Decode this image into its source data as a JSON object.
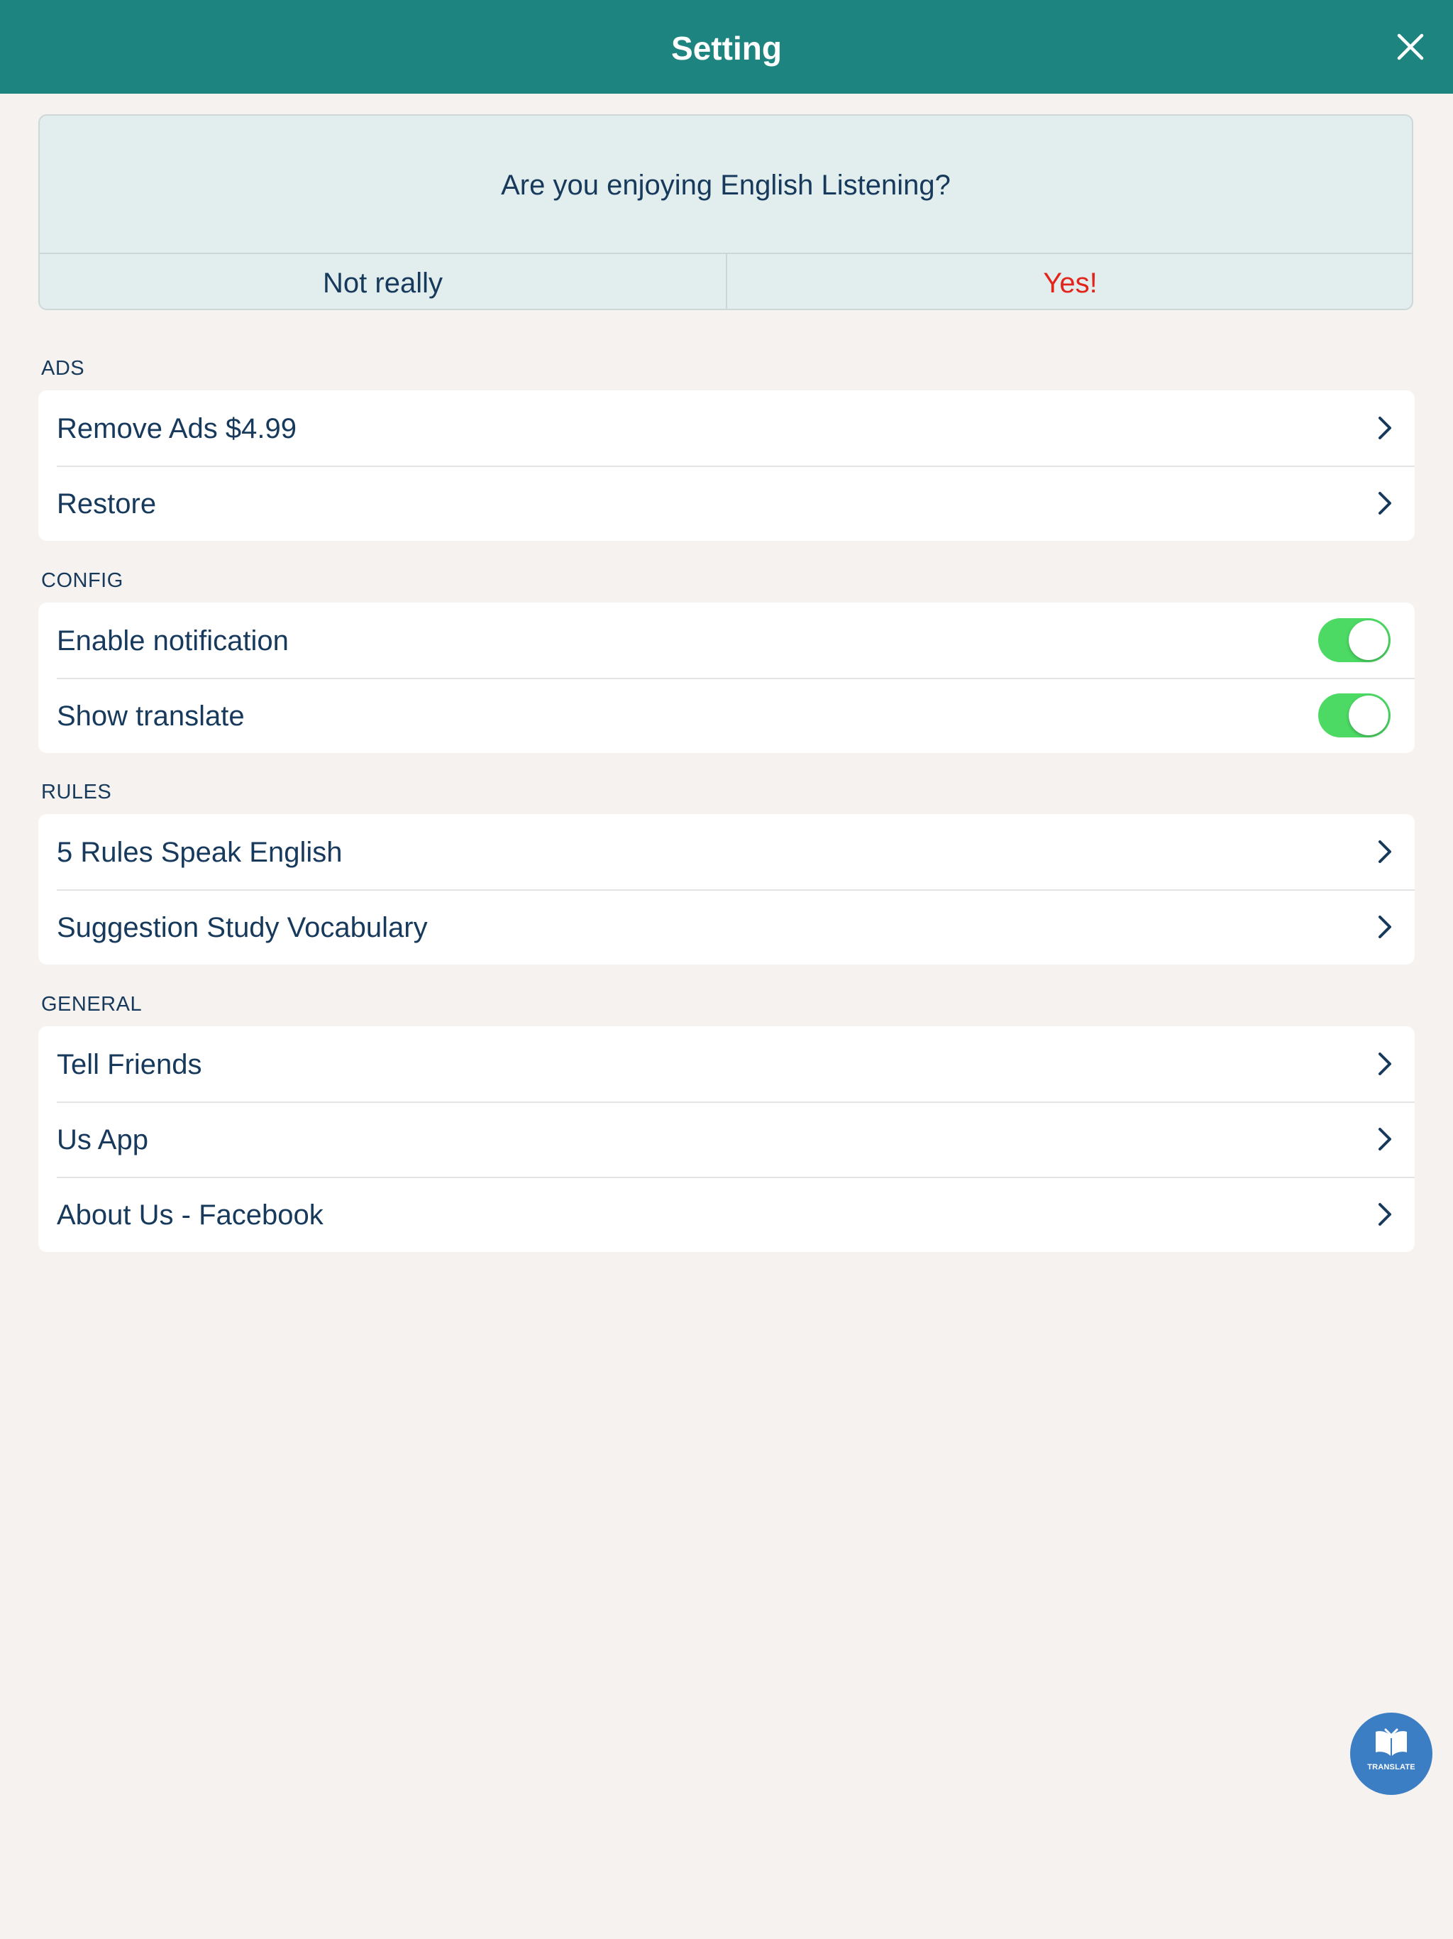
{
  "header": {
    "title": "Setting",
    "close_icon": "close-icon",
    "background_color": "#1e8480"
  },
  "rating_prompt": {
    "question": "Are you enjoying English Listening?",
    "negative_label": "Not really",
    "positive_label": "Yes!",
    "positive_color": "#e3241b"
  },
  "sections": {
    "ads": {
      "header": "ADS",
      "items": [
        {
          "label": "Remove Ads $4.99",
          "accessory": "chevron-right-icon"
        },
        {
          "label": "Restore",
          "accessory": "chevron-right-icon"
        }
      ]
    },
    "config": {
      "header": "CONFIG",
      "items": [
        {
          "label": "Enable notification",
          "toggle_on": true
        },
        {
          "label": "Show translate",
          "toggle_on": true
        }
      ]
    },
    "rules": {
      "header": "RULES",
      "items": [
        {
          "label": "5 Rules Speak English",
          "accessory": "chevron-right-icon"
        },
        {
          "label": "Suggestion Study Vocabulary",
          "accessory": "chevron-right-icon"
        }
      ]
    },
    "general": {
      "header": "GENERAL",
      "items": [
        {
          "label": "Tell Friends",
          "accessory": "chevron-right-icon"
        },
        {
          "label": "Us App",
          "accessory": "chevron-right-icon"
        },
        {
          "label": "About Us - Facebook",
          "accessory": "chevron-right-icon"
        }
      ]
    }
  },
  "translate_button": {
    "label": "TRANSLATE",
    "icon": "book-icon",
    "color": "#3b7ec4"
  },
  "toggle_color": "#4cd964"
}
